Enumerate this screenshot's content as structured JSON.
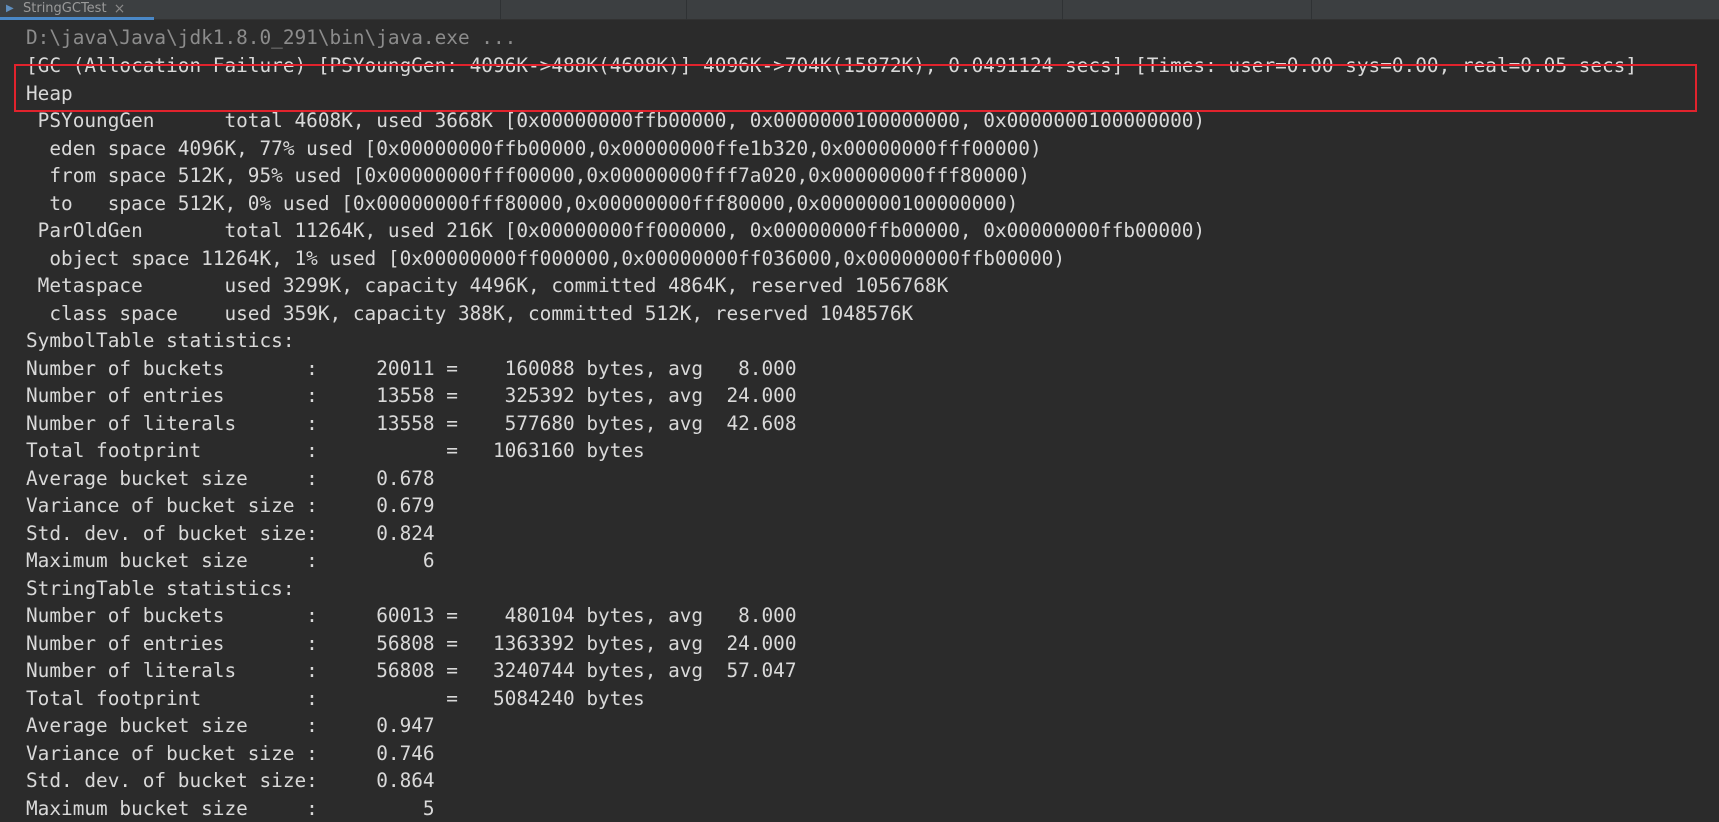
{
  "tab": {
    "icon": "run-console-icon",
    "label": "StringGCTest",
    "close_glyph": "×"
  },
  "console": {
    "command_line": "D:\\java\\Java\\jdk1.8.0_291\\bin\\java.exe ...",
    "lines": [
      "[GC (Allocation Failure) [PSYoungGen: 4096K->488K(4608K)] 4096K->704K(15872K), 0.0491124 secs] [Times: user=0.00 sys=0.00, real=0.05 secs]",
      "Heap",
      " PSYoungGen      total 4608K, used 3668K [0x00000000ffb00000, 0x0000000100000000, 0x0000000100000000)",
      "  eden space 4096K, 77% used [0x00000000ffb00000,0x00000000ffe1b320,0x00000000fff00000)",
      "  from space 512K, 95% used [0x00000000fff00000,0x00000000fff7a020,0x00000000fff80000)",
      "  to   space 512K, 0% used [0x00000000fff80000,0x00000000fff80000,0x0000000100000000)",
      " ParOldGen       total 11264K, used 216K [0x00000000ff000000, 0x00000000ffb00000, 0x00000000ffb00000)",
      "  object space 11264K, 1% used [0x00000000ff000000,0x00000000ff036000,0x00000000ffb00000)",
      " Metaspace       used 3299K, capacity 4496K, committed 4864K, reserved 1056768K",
      "  class space    used 359K, capacity 388K, committed 512K, reserved 1048576K",
      "SymbolTable statistics:",
      "Number of buckets       :     20011 =    160088 bytes, avg   8.000",
      "Number of entries       :     13558 =    325392 bytes, avg  24.000",
      "Number of literals      :     13558 =    577680 bytes, avg  42.608",
      "Total footprint         :           =   1063160 bytes",
      "Average bucket size     :     0.678",
      "Variance of bucket size :     0.679",
      "Std. dev. of bucket size:     0.824",
      "Maximum bucket size     :         6",
      "StringTable statistics:",
      "Number of buckets       :     60013 =    480104 bytes, avg   8.000",
      "Number of entries       :     56808 =   1363392 bytes, avg  24.000",
      "Number of literals      :     56808 =   3240744 bytes, avg  57.047",
      "Total footprint         :           =   5084240 bytes",
      "Average bucket size     :     0.947",
      "Variance of bucket size :     0.746",
      "Std. dev. of bucket size:     0.864",
      "Maximum bucket size     :         5"
    ]
  },
  "colors": {
    "background": "#2b2b2b",
    "text": "#d9d9d9",
    "command_text": "#8c8c8c",
    "highlight_border": "#e1232d",
    "tab_underline": "#4a88c7"
  }
}
